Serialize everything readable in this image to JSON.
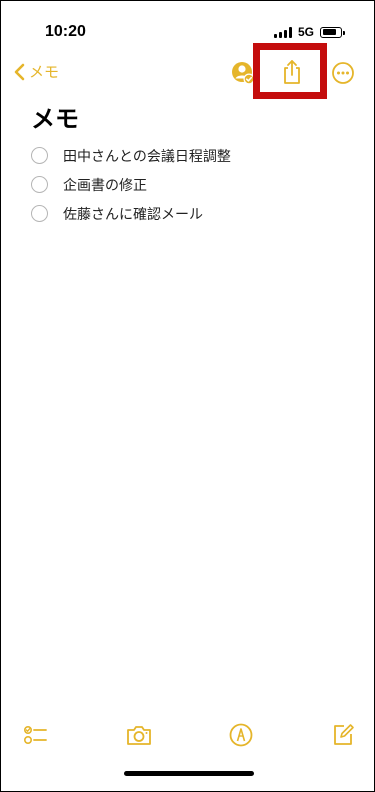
{
  "status_bar": {
    "time": "10:20",
    "network": "5G"
  },
  "nav": {
    "back_label": "メモ",
    "icons": {
      "back": "chevron-left-icon",
      "collaborate": "person-checkmark-icon",
      "share": "share-icon",
      "more": "ellipsis-circle-icon"
    }
  },
  "note": {
    "title": "メモ",
    "checklist": [
      {
        "text": "田中さんとの会議日程調整",
        "checked": false
      },
      {
        "text": "企画書の修正",
        "checked": false
      },
      {
        "text": "佐藤さんに確認メール",
        "checked": false
      }
    ]
  },
  "toolbar": {
    "icons": [
      "checklist-icon",
      "camera-icon",
      "markup-icon",
      "compose-icon"
    ]
  },
  "colors": {
    "accent": "#e5b52a",
    "highlight": "#c40d0d",
    "checkbox_border": "#b5b5b5"
  }
}
